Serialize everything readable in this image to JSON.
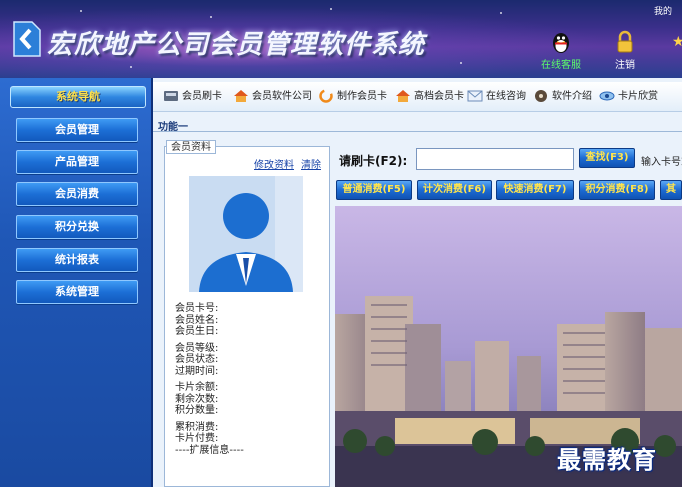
{
  "header": {
    "title": "宏欣地产公司会员管理软件系统",
    "user_text": "我的",
    "buttons": [
      {
        "label": "在线客服",
        "icon": "qq-penguin-icon"
      },
      {
        "label": "注销",
        "icon": "lock-icon"
      }
    ]
  },
  "sidebar": {
    "heading": "系统导航",
    "items": [
      {
        "label": "会员管理"
      },
      {
        "label": "产品管理"
      },
      {
        "label": "会员消费"
      },
      {
        "label": "积分兑换"
      },
      {
        "label": "统计报表"
      },
      {
        "label": "系统管理"
      }
    ]
  },
  "toolbar": {
    "items": [
      {
        "label": "会员刷卡",
        "icon": "card-reader-icon"
      },
      {
        "label": "会员软件公司",
        "icon": "house-icon"
      },
      {
        "label": "制作会员卡",
        "icon": "refresh-icon"
      },
      {
        "label": "高档会员卡",
        "icon": "house-icon"
      },
      {
        "label": "在线咨询",
        "icon": "mail-icon"
      },
      {
        "label": "软件介绍",
        "icon": "disc-icon"
      },
      {
        "label": "卡片欣赏",
        "icon": "eye-icon"
      }
    ]
  },
  "function_label": "功能一",
  "member": {
    "legend": "会员资料",
    "edit_link": "修改资料",
    "clear_link": "清除",
    "fields": [
      "会员卡号:",
      "会员姓名:",
      "会员生日:",
      "会员等级:",
      "会员状态:",
      "过期时间:",
      "卡片余额:",
      "剩余次数:",
      "积分数量:",
      "累积消费:",
      "卡片付费:",
      "----扩展信息----"
    ]
  },
  "card": {
    "label": "请刷卡(F2):",
    "input_value": "",
    "search_button": "查找(F3)",
    "hint": "输入卡号或"
  },
  "actions": [
    "普通消费(F5)",
    "计次消费(F6)",
    "快速消费(F7)",
    "积分消费(F8)",
    "其"
  ],
  "watermark": "最需教育",
  "colors": {
    "accent": "#1d6bd3",
    "button_text": "#ffe44c",
    "sidebar": "#1f57b6"
  }
}
